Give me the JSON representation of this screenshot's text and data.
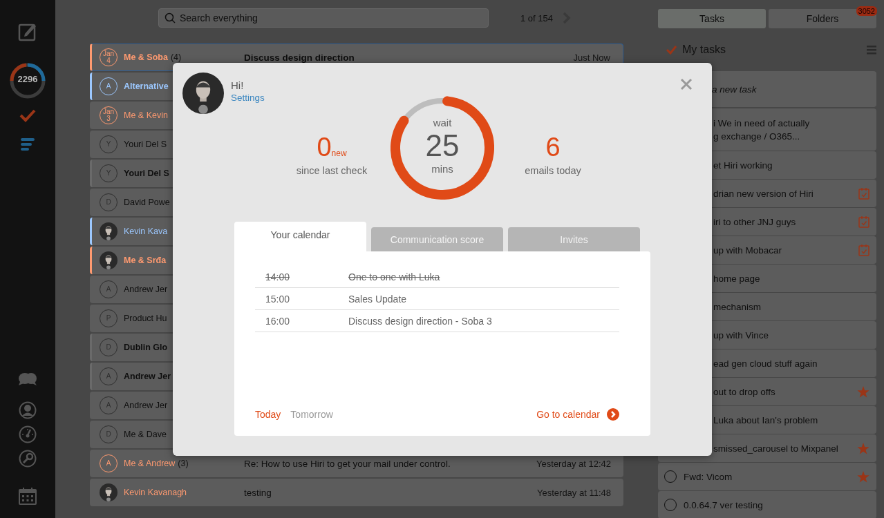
{
  "sidebar": {
    "counter": "2296"
  },
  "search": {
    "placeholder": "Search everything"
  },
  "pager": {
    "text": "1 of 154"
  },
  "emails": [
    {
      "name": "Me & Soba",
      "count": "(4)",
      "subject": "Discuss design direction",
      "time": "Just Now",
      "avatar": {
        "kind": "date",
        "month": "Jan",
        "day": "4"
      },
      "color": "#ff9a70",
      "flagged": true,
      "unread": true,
      "selected": true
    },
    {
      "name": "Alternative",
      "avatar": {
        "kind": "letter",
        "text": "A"
      },
      "color": "#9cc8ff",
      "flagged": true,
      "unread": true,
      "selected": false
    },
    {
      "name": "Me & Kevin",
      "avatar": {
        "kind": "date",
        "month": "Jan",
        "day": "3"
      },
      "color": "#ff9a70",
      "flagged": false,
      "unread": false,
      "selected": false
    },
    {
      "name": "Youri Del S",
      "avatar": {
        "kind": "letter",
        "text": "Y"
      },
      "flagged": false,
      "unread": false,
      "selected": false
    },
    {
      "name": "Youri Del S",
      "avatar": {
        "kind": "letter",
        "text": "Y"
      },
      "flagged": true,
      "unread": true,
      "selected": false
    },
    {
      "name": "David Powe",
      "avatar": {
        "kind": "letter",
        "text": "D"
      },
      "flagged": false,
      "unread": false,
      "selected": false
    },
    {
      "name": "Kevin Kava",
      "color": "#9cc8ff",
      "flagged": true,
      "unread": false,
      "selected": false
    },
    {
      "name": "Me & Srđa",
      "color": "#ff9a70",
      "flagged": true,
      "unread": true,
      "selected": false
    },
    {
      "name": "Andrew Jer",
      "avatar": {
        "kind": "letter",
        "text": "A"
      },
      "flagged": false,
      "unread": false,
      "selected": false
    },
    {
      "name": "Product Hu",
      "avatar": {
        "kind": "letter",
        "text": "P"
      },
      "flagged": false,
      "unread": false,
      "selected": false
    },
    {
      "name": "Dublin Glo",
      "avatar": {
        "kind": "letter",
        "text": "D"
      },
      "flagged": true,
      "unread": true,
      "selected": false
    },
    {
      "name": "Andrew Jer",
      "avatar": {
        "kind": "letter",
        "text": "A"
      },
      "flagged": true,
      "unread": true,
      "selected": false
    },
    {
      "name": "Andrew Jer",
      "avatar": {
        "kind": "letter",
        "text": "A"
      },
      "flagged": false,
      "unread": false,
      "selected": false
    },
    {
      "name": "Me & Dave",
      "avatar": {
        "kind": "letter",
        "text": "D"
      },
      "flagged": false,
      "unread": false,
      "selected": false
    },
    {
      "name": "Me & Andrew",
      "count": "(3)",
      "subject": "Re: How to use Hiri to get your mail under control.",
      "time": "Yesterday at 12:42",
      "avatar": {
        "kind": "letter",
        "text": "A"
      },
      "color": "#ff9a70",
      "flagged": false,
      "unread": false,
      "selected": false
    },
    {
      "name": "Kevin Kavanagh",
      "subject": "testing",
      "time": "Yesterday at 11:48",
      "color": "#ff9a70",
      "flagged": false,
      "unread": false,
      "selected": false
    }
  ],
  "tasks_panel": {
    "tabs": [
      {
        "label": "Tasks",
        "selected": true
      },
      {
        "label": "Folders",
        "selected": false,
        "badge": "3052"
      }
    ],
    "title": "My tasks",
    "new_task": {
      "placeholder": "a new task"
    },
    "items": [
      {
        "kind": "partial",
        "lines": [
          "i We in need of actually",
          "g exchange / O365..."
        ],
        "scheduled": false,
        "starred": false
      },
      {
        "kind": "partial",
        "lines": [
          "et Hiri working"
        ],
        "scheduled": false,
        "starred": false
      },
      {
        "kind": "partial",
        "lines": [
          "drian new version of Hiri"
        ],
        "scheduled": true,
        "starred": false
      },
      {
        "kind": "partial",
        "lines": [
          "iri to other JNJ guys"
        ],
        "scheduled": true,
        "starred": false
      },
      {
        "kind": "partial",
        "lines": [
          "up with Mobacar"
        ],
        "scheduled": true,
        "starred": false
      },
      {
        "kind": "partial",
        "lines": [
          "home page"
        ],
        "scheduled": false,
        "starred": false
      },
      {
        "kind": "partial",
        "lines": [
          "mechanism"
        ],
        "scheduled": false,
        "starred": false
      },
      {
        "kind": "partial",
        "lines": [
          "up with Vince"
        ],
        "scheduled": false,
        "starred": false
      },
      {
        "kind": "partial",
        "lines": [
          "ead gen cloud stuff again"
        ],
        "scheduled": false,
        "starred": false
      },
      {
        "kind": "partial",
        "lines": [
          "out to drop offs"
        ],
        "scheduled": false,
        "starred": true
      },
      {
        "kind": "partial",
        "lines": [
          "Luka about Ian's problem"
        ],
        "scheduled": false,
        "starred": false
      },
      {
        "kind": "partial",
        "lines": [
          "smissed_carousel to Mixpanel"
        ],
        "scheduled": false,
        "starred": true
      },
      {
        "kind": "task",
        "lines": [
          "Fwd: Vicom"
        ],
        "scheduled": false,
        "starred": true,
        "done": false
      },
      {
        "kind": "task",
        "lines": [
          "0.0.64.7 ver testing"
        ],
        "scheduled": false,
        "starred": false,
        "done": false
      }
    ]
  },
  "modal": {
    "greeting": "Hi!",
    "settings_link": "Settings",
    "left_stat": {
      "value": "0",
      "suffix": "new",
      "label": "since last check"
    },
    "timer": {
      "top": "wait",
      "value": "25",
      "bottom": "mins"
    },
    "right_stat": {
      "value": "6",
      "label": "emails today"
    },
    "tabs": [
      {
        "label": "Your calendar",
        "selected": true
      },
      {
        "label": "Communication score",
        "selected": false
      },
      {
        "label": "Invites",
        "selected": false
      }
    ],
    "events": [
      {
        "time": "14:00",
        "title": "One to one with Luka",
        "done": true
      },
      {
        "time": "15:00",
        "title": "Sales Update",
        "done": false
      },
      {
        "time": "16:00",
        "title": "Discuss design direction - Soba 3",
        "done": false
      }
    ],
    "days": [
      {
        "label": "Today",
        "selected": true
      },
      {
        "label": "Tomorrow",
        "selected": false
      }
    ],
    "calendar_link": "Go to calendar"
  }
}
